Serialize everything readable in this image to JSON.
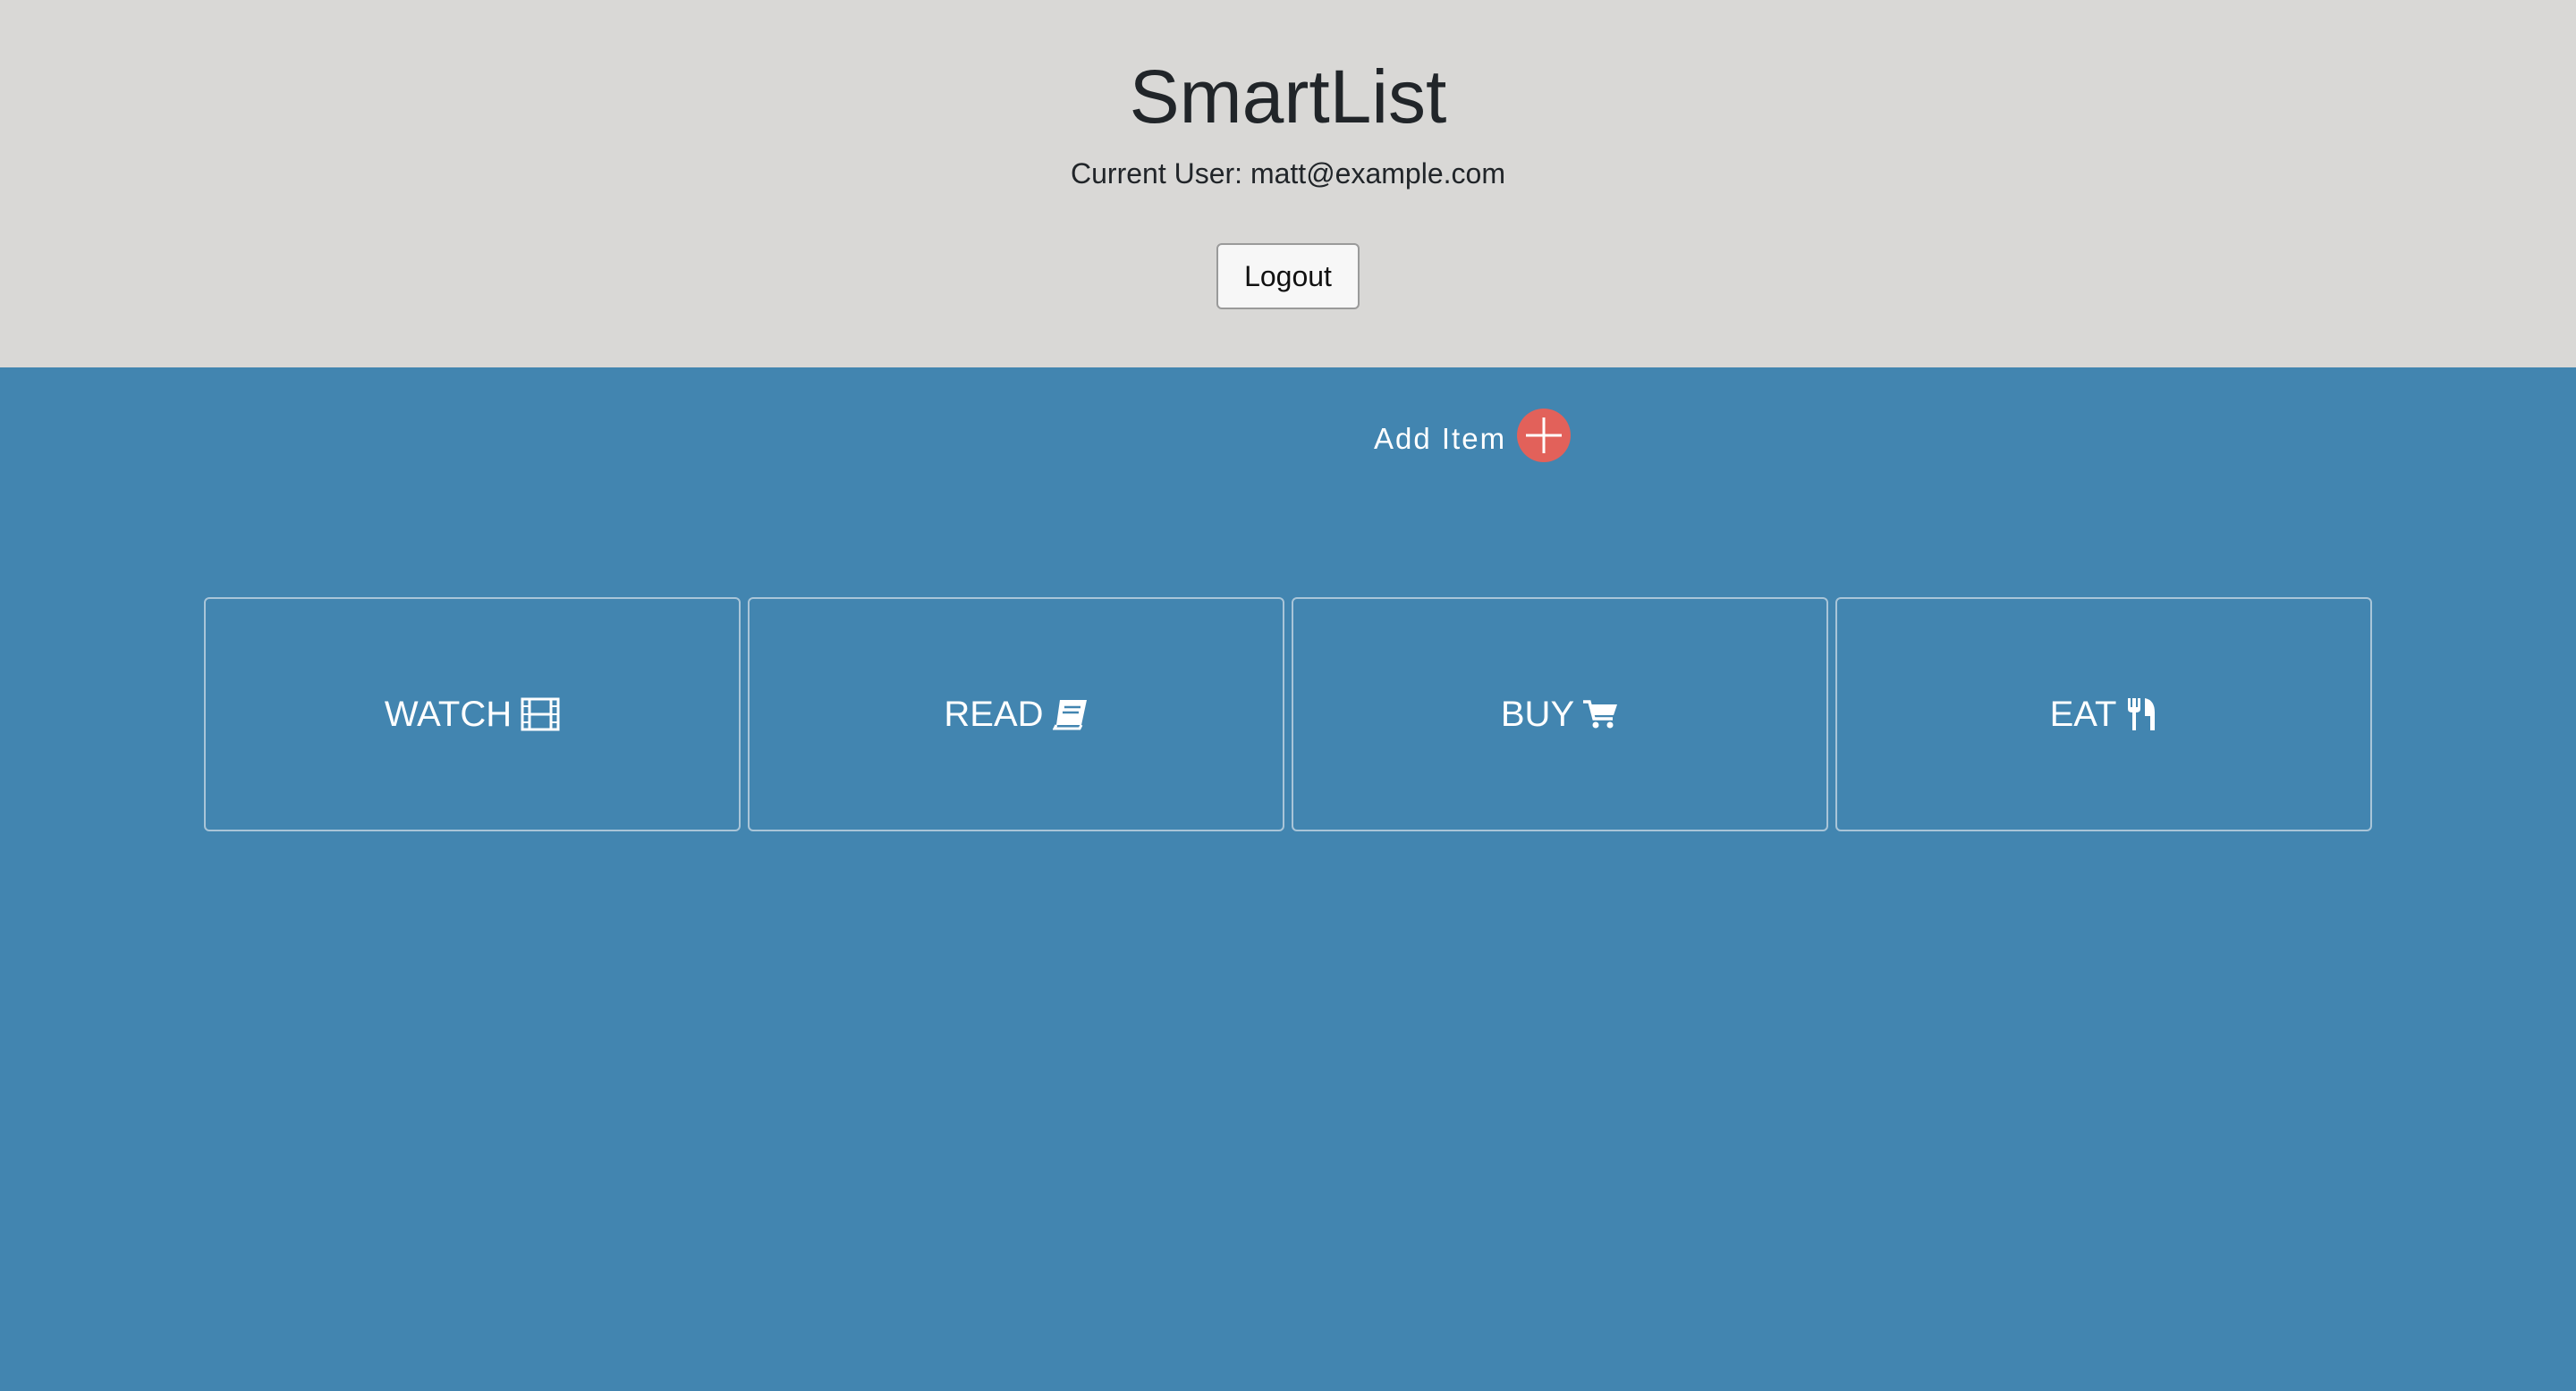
{
  "header": {
    "title": "SmartList",
    "current_user": "Current User: matt@example.com",
    "logout_label": "Logout"
  },
  "main": {
    "add_item_label": "Add Item",
    "categories": [
      {
        "label": "WATCH",
        "icon": "film-icon"
      },
      {
        "label": "READ",
        "icon": "book-icon"
      },
      {
        "label": "BUY",
        "icon": "shopping-cart-icon"
      },
      {
        "label": "EAT",
        "icon": "utensils-icon"
      }
    ]
  },
  "colors": {
    "header_bg": "#d9d8d6",
    "main_bg": "#4285b0",
    "add_button": "#e2615a",
    "card_border": "#a9c5d8"
  }
}
